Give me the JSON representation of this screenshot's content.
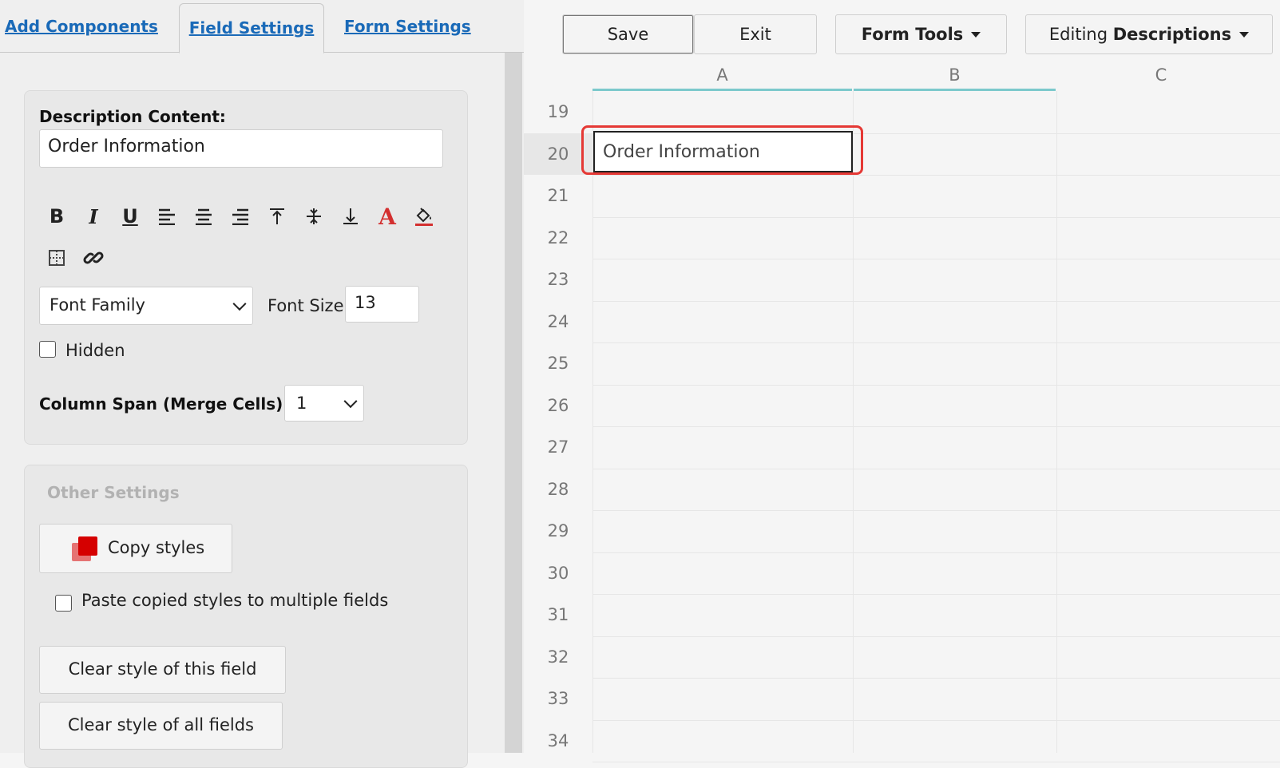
{
  "tabs": [
    {
      "label": "Add Components"
    },
    {
      "label": "Field Settings"
    },
    {
      "label": "Form Settings"
    }
  ],
  "description": {
    "label": "Description Content:",
    "value": "Order Information"
  },
  "toolbar": {
    "icons": [
      "bold-icon",
      "italic-icon",
      "underline-icon",
      "align-left-icon",
      "align-center-icon",
      "align-right-icon",
      "valign-top-icon",
      "valign-middle-icon",
      "valign-bottom-icon",
      "font-color-icon",
      "fill-color-icon",
      "border-icon",
      "link-icon"
    ],
    "font_color": "#d32f2f"
  },
  "font": {
    "family_placeholder": "Font Family",
    "size_label": "Font Size",
    "size_value": "13"
  },
  "hidden_label": "Hidden",
  "column_span": {
    "label": "Column Span (Merge Cells):",
    "value": "1"
  },
  "other_settings": {
    "title": "Other Settings",
    "copy_styles": "Copy styles",
    "paste_label": "Paste copied styles to multiple fields",
    "clear_field": "Clear style of this field",
    "clear_all": "Clear style of all fields"
  },
  "topbar": {
    "save": "Save",
    "exit": "Exit",
    "form_tools": "Form Tools",
    "editing_prefix": "Editing",
    "editing_mode": "Descriptions"
  },
  "grid": {
    "columns": [
      "A",
      "B",
      "C"
    ],
    "rows": [
      "19",
      "20",
      "21",
      "22",
      "23",
      "24",
      "25",
      "26",
      "27",
      "28",
      "29",
      "30",
      "31",
      "32",
      "33",
      "34"
    ],
    "selected_cell_text": "Order Information",
    "highlight_color": "#e53935"
  }
}
